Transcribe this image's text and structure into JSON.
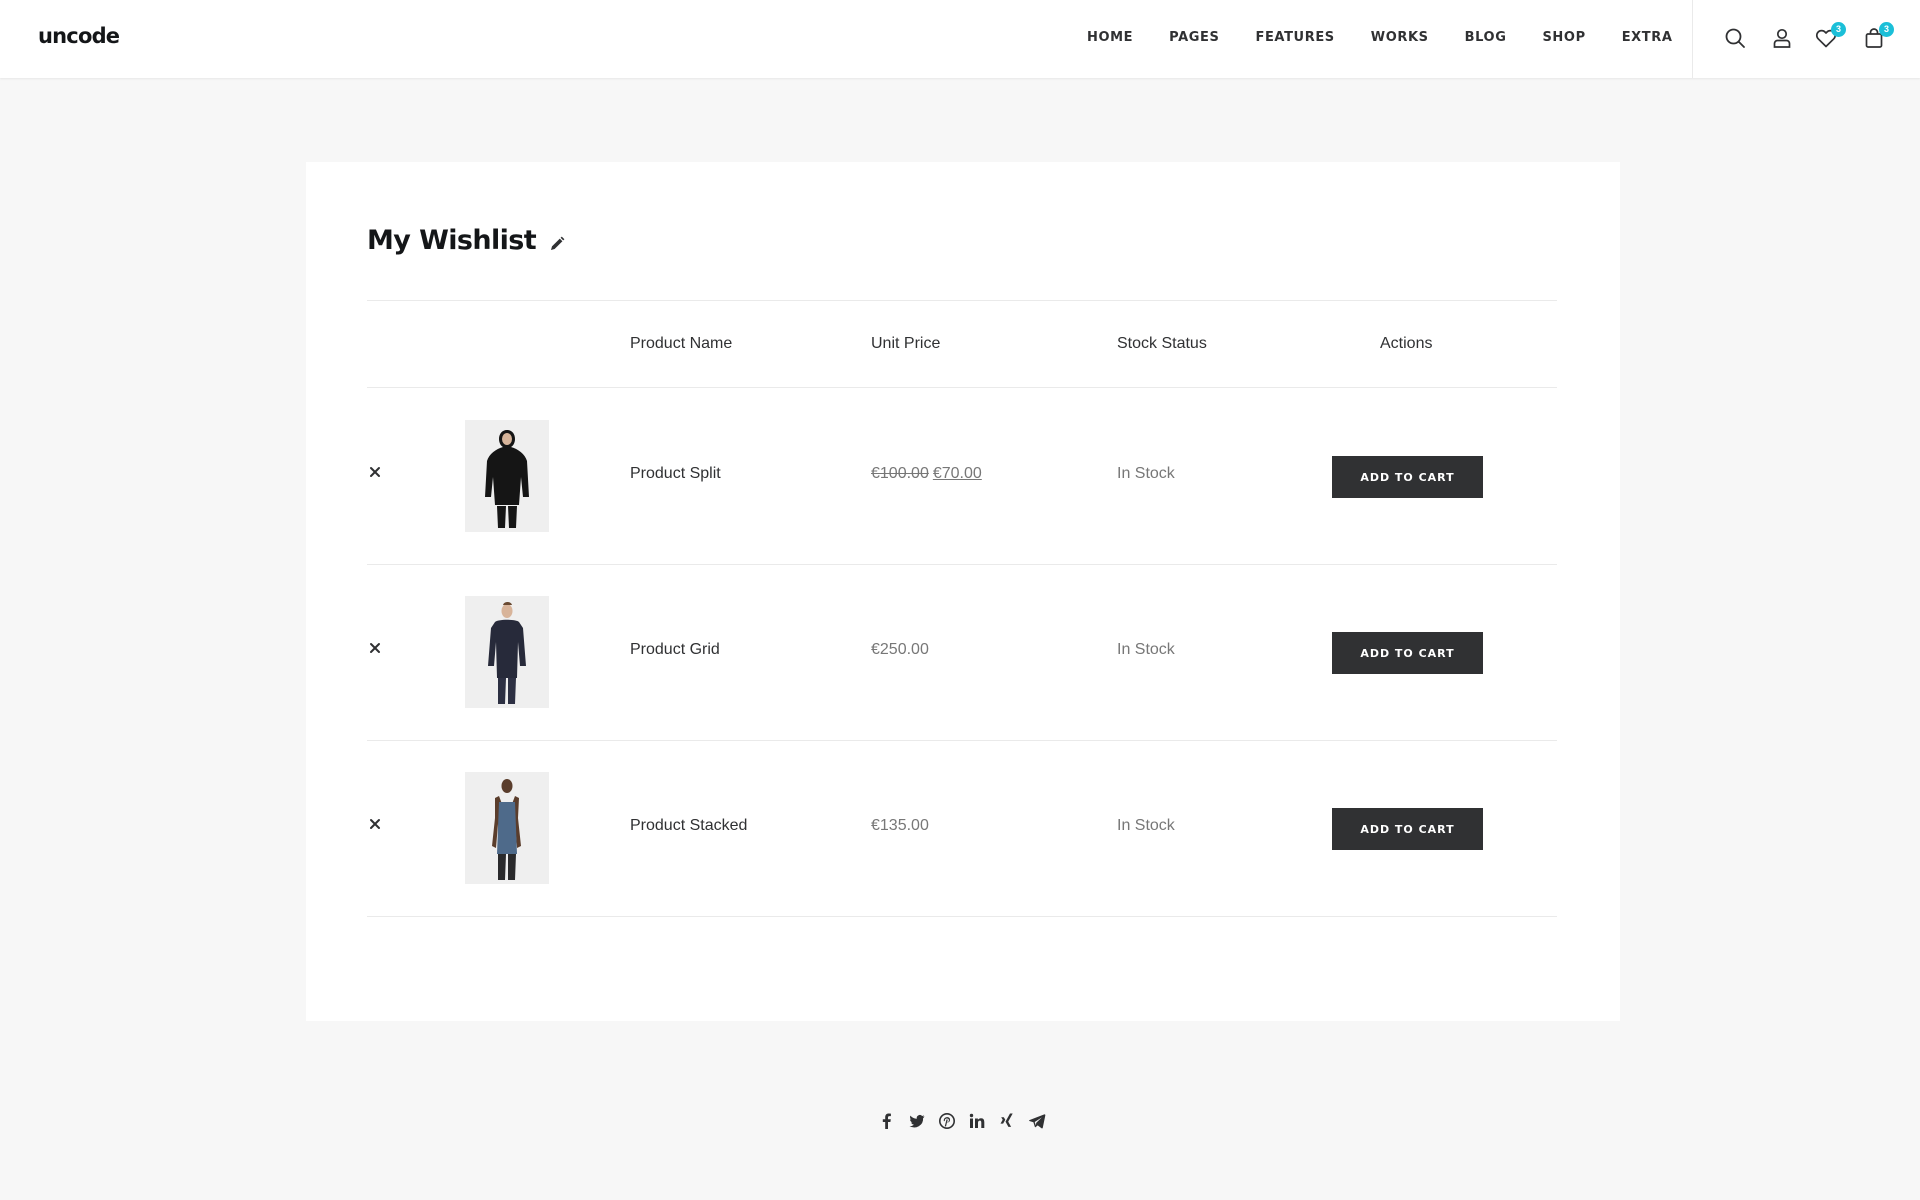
{
  "brand": {
    "logo_text": "uncode",
    "accent_color": "#1bbfd8"
  },
  "nav": {
    "items": [
      {
        "label": "HOME"
      },
      {
        "label": "PAGES"
      },
      {
        "label": "FEATURES"
      },
      {
        "label": "WORKS"
      },
      {
        "label": "BLOG"
      },
      {
        "label": "SHOP"
      },
      {
        "label": "EXTRA"
      }
    ]
  },
  "header_icons": {
    "search": {
      "icon": "search-icon"
    },
    "account": {
      "icon": "user-icon"
    },
    "wishlist": {
      "icon": "heart-icon",
      "count": "3"
    },
    "cart": {
      "icon": "shopping-bag-icon",
      "count": "3"
    }
  },
  "wishlist": {
    "title": "My Wishlist",
    "edit_icon": "pencil-icon",
    "columns": {
      "product_name": "Product Name",
      "unit_price": "Unit Price",
      "stock_status": "Stock Status",
      "actions": "Actions"
    },
    "items": [
      {
        "name": "Product Split",
        "old_price": "€100.00",
        "price": "€70.00",
        "stock": "In Stock",
        "button": "ADD TO CART",
        "image": "black-hoodie"
      },
      {
        "name": "Product Grid",
        "old_price": "",
        "price": "€250.00",
        "stock": "In Stock",
        "button": "ADD TO CART",
        "image": "navy-jacket"
      },
      {
        "name": "Product Stacked",
        "old_price": "",
        "price": "€135.00",
        "stock": "In Stock",
        "button": "ADD TO CART",
        "image": "blue-tank-top"
      }
    ]
  },
  "share": {
    "icons": [
      "facebook-icon",
      "twitter-icon",
      "pinterest-icon",
      "linkedin-icon",
      "xing-icon",
      "telegram-icon"
    ]
  }
}
